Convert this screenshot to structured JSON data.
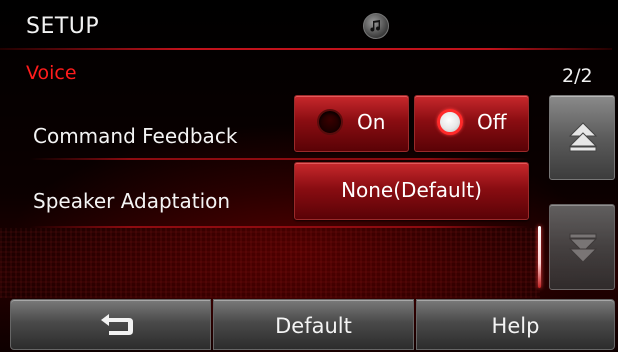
{
  "header": {
    "title": "SETUP",
    "center_icon": "music-note-icon"
  },
  "section": {
    "title": "Voice",
    "page_indicator": "2/2"
  },
  "settings": [
    {
      "label": "Command Feedback",
      "type": "radio-group",
      "options": [
        {
          "label": "On",
          "selected": false
        },
        {
          "label": "Off",
          "selected": true
        }
      ]
    },
    {
      "label": "Speaker Adaptation",
      "type": "button",
      "value": "None(Default)"
    }
  ],
  "scroll": {
    "up_icon": "scroll-up-icon",
    "down_icon": "scroll-down-icon",
    "down_enabled": false
  },
  "bottom_bar": {
    "back_icon": "back-arrow-icon",
    "default_label": "Default",
    "help_label": "Help"
  },
  "colors": {
    "accent_red": "#ff1c1c",
    "button_red": "#a3141a",
    "text": "#f4f4f4"
  }
}
